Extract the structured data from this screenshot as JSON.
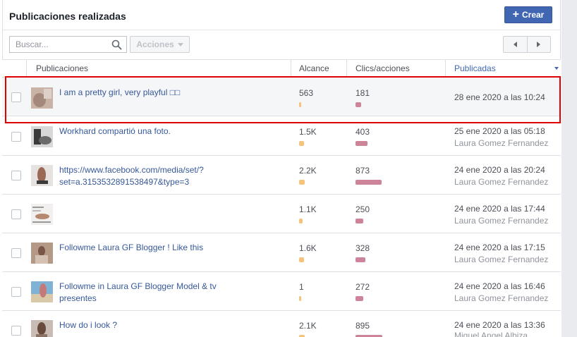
{
  "header": {
    "title": "Publicaciones realizadas",
    "create_label": "Crear"
  },
  "toolbar": {
    "search_placeholder": "Buscar...",
    "actions_label": "Acciones"
  },
  "columns": {
    "posts": "Publicaciones",
    "reach": "Alcance",
    "clicks": "Clics/acciones",
    "published": "Publicadas"
  },
  "colors": {
    "accent": "#4267b2",
    "link": "#365899",
    "reach_bar": "#f7c27a",
    "clicks_bar": "#cd8499",
    "highlight": "#e00000"
  },
  "rows": [
    {
      "text": "I am a pretty girl, very playful □□",
      "reach": "563",
      "reach_fraction": 0.01,
      "clicks": "181",
      "clicks_fraction": 0.2,
      "date": "28 ene 2020 a las 10:24",
      "author": ""
    },
    {
      "text": "Workhard compartió una foto.",
      "reach": "1.5K",
      "reach_fraction": 0.15,
      "clicks": "403",
      "clicks_fraction": 0.45,
      "date": "25 ene 2020 a las 05:18",
      "author": "Laura Gomez Fernandez"
    },
    {
      "text": "https://www.facebook.com/media/set/?set=a.315353289153849​7&type=3",
      "reach": "2.2K",
      "reach_fraction": 0.2,
      "clicks": "873",
      "clicks_fraction": 0.97,
      "date": "24 ene 2020 a las 20:24",
      "author": "Laura Gomez Fernandez"
    },
    {
      "text": "",
      "reach": "1.1K",
      "reach_fraction": 0.1,
      "clicks": "250",
      "clicks_fraction": 0.28,
      "date": "24 ene 2020 a las 17:44",
      "author": "Laura Gomez Fernandez"
    },
    {
      "text": "Followme Laura GF Blogger ! Like this",
      "reach": "1.6K",
      "reach_fraction": 0.15,
      "clicks": "328",
      "clicks_fraction": 0.36,
      "date": "24 ene 2020 a las 17:15",
      "author": "Laura Gomez Fernandez"
    },
    {
      "text": "Followme in Laura GF Blogger Model & tv presentes",
      "reach": "1",
      "reach_fraction": 0.005,
      "clicks": "272",
      "clicks_fraction": 0.3,
      "date": "24 ene 2020 a las 16:46",
      "author": "Laura Gomez Fernandez"
    },
    {
      "text": "How do i look ?",
      "reach": "2.1K",
      "reach_fraction": 0.2,
      "clicks": "895",
      "clicks_fraction": 1.0,
      "date": "24 ene 2020 a las 13:36",
      "author": "Miguel Angel Albiza"
    }
  ]
}
